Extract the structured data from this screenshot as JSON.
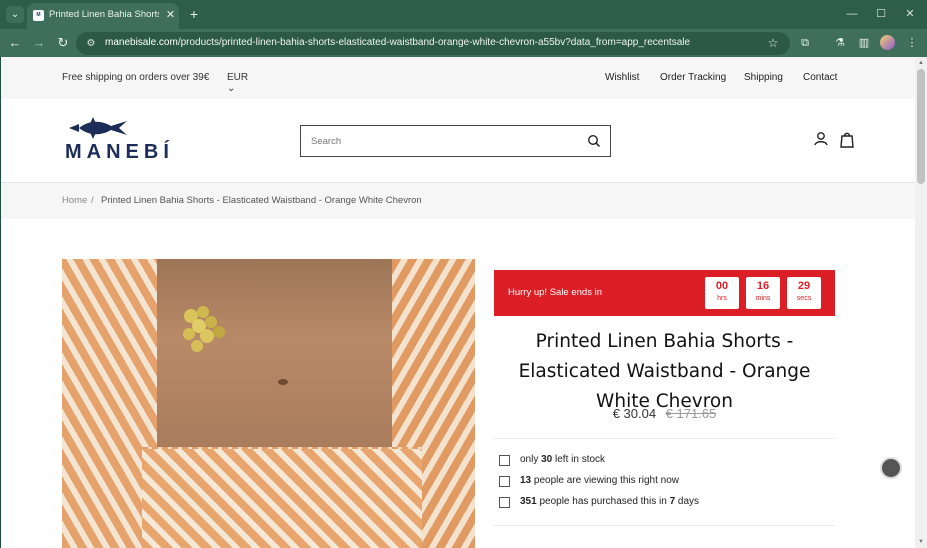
{
  "browser": {
    "tab_title": "Printed Linen Bahia Shorts - El",
    "url_host": "manebisale.com",
    "url_path": "/products/printed-linen-bahia-shorts-elasticated-waistband-orange-white-chevron-a55bv?data_from=app_recentsale"
  },
  "topbar": {
    "shipping_note": "Free shipping on orders over 39€",
    "currency": "EUR",
    "links": [
      "Wishlist",
      "Order Tracking",
      "Shipping",
      "Contact"
    ]
  },
  "header": {
    "logo_text": "MANEBÍ",
    "search_placeholder": "Search"
  },
  "breadcrumb": {
    "home": "Home",
    "separator": "/",
    "current": "Printed Linen Bahia Shorts - Elasticated Waistband - Orange White Chevron"
  },
  "countdown": {
    "label": "Hurry up!  Sale ends in",
    "hours": "00",
    "hours_unit": "hrs",
    "mins": "16",
    "mins_unit": "mins",
    "secs": "29",
    "secs_unit": "secs",
    "color": "#dc1f26"
  },
  "product": {
    "title": "Printed Linen Bahia Shorts - Elasticated Waistband - Orange White Chevron",
    "price": "€ 30.04",
    "old_price": "€ 171.65"
  },
  "stats": {
    "stock_pre": "only ",
    "stock_num": "30",
    "stock_post": " left in stock",
    "viewing_num": "13",
    "viewing_post": " people are viewing this right now",
    "purchased_num": "351",
    "purchased_mid": " people has purchased this in ",
    "purchased_days": "7",
    "purchased_post": " days"
  }
}
